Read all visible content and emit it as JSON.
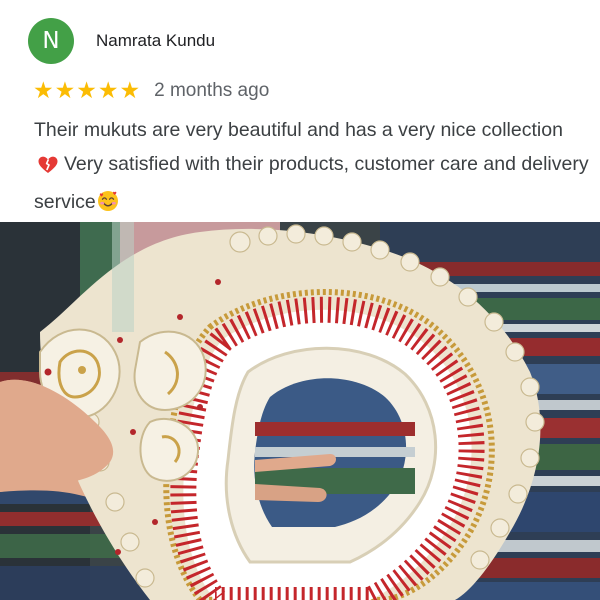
{
  "reviewer": {
    "initial": "N",
    "name": "Namrata Kundu",
    "avatar_color": "#43a047"
  },
  "review": {
    "rating": 5,
    "rating_max": 5,
    "star_color": "#fbbc04",
    "date": "2 months ago",
    "text_part1": "Their mukuts are very beautiful and has a very nice collection",
    "text_part2": "Very satisfied with their products, customer care and delivery service",
    "emojis": [
      "heart-emoji",
      "smiling-face-with-hearts-emoji"
    ]
  },
  "photo": {
    "subject": "white and red decorative mukut held over striped fabric"
  }
}
